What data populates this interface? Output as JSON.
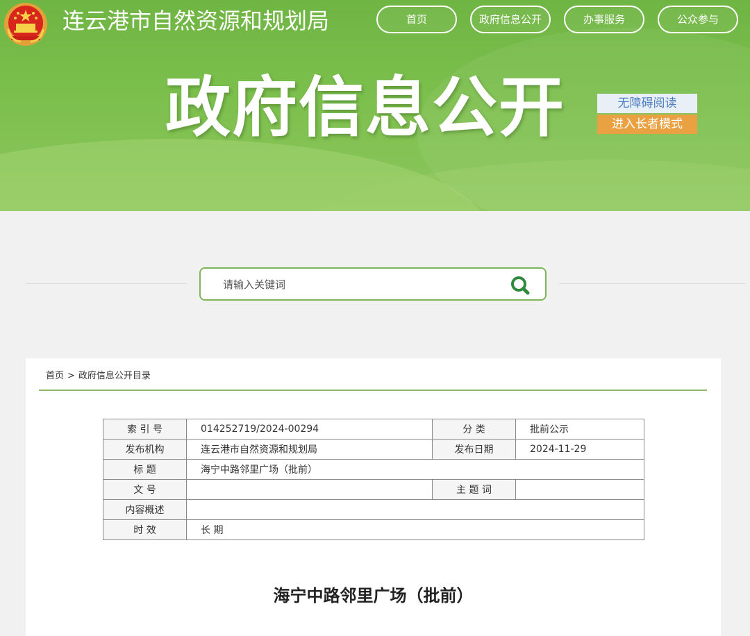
{
  "header": {
    "site_name": "连云港市自然资源和规划局",
    "big_title": "政府信息公开",
    "nav": [
      "首页",
      "政府信息公开",
      "办事服务",
      "公众参与"
    ],
    "accessibility_label": "无障碍阅读",
    "elder_mode_label": "进入长者模式"
  },
  "search": {
    "placeholder": "请输入关键词"
  },
  "breadcrumb": {
    "home": "首页",
    "separator": ">",
    "current": "政府信息公开目录"
  },
  "meta": {
    "index_no_label": "索 引 号",
    "index_no": "014252719/2024-00294",
    "category_label": "分 类",
    "category": "批前公示",
    "publisher_label": "发布机构",
    "publisher": "连云港市自然资源和规划局",
    "date_label": "发布日期",
    "date": "2024-11-29",
    "title_label": "标 题",
    "title": "海宁中路邻里广场（批前）",
    "doc_no_label": "文 号",
    "doc_no": "",
    "keywords_label": "主 题 词",
    "keywords": "",
    "summary_label": "内容概述",
    "summary": "",
    "validity_label": "时 效",
    "validity": "长 期"
  },
  "document": {
    "title": "海宁中路邻里广场（批前）"
  },
  "colors": {
    "header_green": "#7cbf4d",
    "search_border": "#7fb55a",
    "elder_orange": "#e9a141",
    "accessibility_blue": "#4f7fbf"
  }
}
